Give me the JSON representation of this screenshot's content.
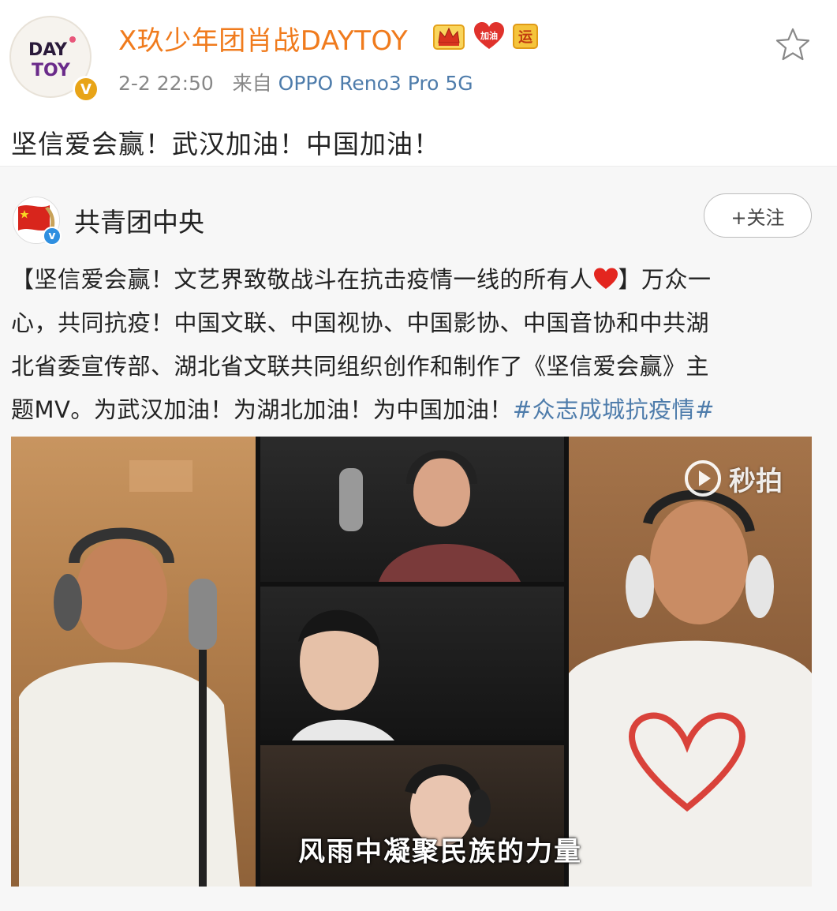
{
  "post": {
    "author": "X玖少年团肖战DAYTOY",
    "avatar_text": "DAY TOY",
    "verified_mark": "V",
    "badge_jiayou": "加油",
    "badge_yun": "运",
    "timestamp": "2-2 22:50",
    "source_prefix": "来自",
    "source_device": "OPPO Reno3 Pro 5G",
    "text": "坚信爱会赢！武汉加油！中国加油！"
  },
  "repost": {
    "author": "共青团中央",
    "follow_label": "+关注",
    "body_lines": [
      "【坚信爱会赢！文艺界致敬战斗在抗击疫情一线的所有人",
      "】万众一",
      "心，共同抗疫！中国文联、中国视协、中国影协、中国音协和中共湖",
      "北省委宣传部、湖北省文联共同组织创作和制作了《坚信爱会赢》主",
      "题MV。为武汉加油！为湖北加油！为中国加油！",
      "#众志成城抗疫情#"
    ],
    "video": {
      "watermark": "秒拍",
      "subtitle": "风雨中凝聚民族的力量"
    }
  },
  "colors": {
    "author_orange": "#f07b1d",
    "link_blue": "#4e7cab",
    "repost_bg": "#f7f7f7"
  },
  "icons": [
    "crown-badge-icon",
    "heart-badge-icon",
    "yun-badge-icon",
    "star-icon",
    "heart-emoji-icon",
    "verified-icon",
    "play-icon"
  ]
}
